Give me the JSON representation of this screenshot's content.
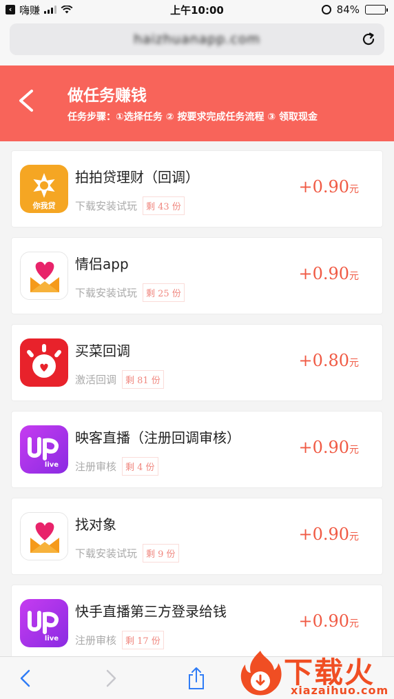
{
  "status_bar": {
    "carrier": "嗨赚",
    "time": "上午10:00",
    "battery": "84%",
    "battery_level": 0.84
  },
  "browser": {
    "url": "haizhuanapp.com"
  },
  "header": {
    "title": "做任务赚钱",
    "steps": "任务步骤：①选择任务 ② 按要求完成任务流程 ③ 领取现金"
  },
  "tasks": [
    {
      "name": "拍拍贷理财（回调）",
      "tag": "下载安装试玩",
      "remaining": "剩 43 份",
      "price": "+0.90",
      "unit": "元",
      "icon": "paipaidai-icon",
      "logo_text": "你我贷"
    },
    {
      "name": "情侣app",
      "tag": "下载安装试玩",
      "remaining": "剩 25 份",
      "price": "+0.90",
      "unit": "元",
      "icon": "heart-envelope-icon"
    },
    {
      "name": "买菜回调",
      "tag": "激活回调",
      "remaining": "剩 81 份",
      "price": "+0.80",
      "unit": "元",
      "icon": "red-face-icon"
    },
    {
      "name": "映客直播（注册回调审核）",
      "tag": "注册审核",
      "remaining": "剩 4 份",
      "price": "+0.90",
      "unit": "元",
      "icon": "up-live-icon",
      "logo_text": "live"
    },
    {
      "name": "找对象",
      "tag": "下载安装试玩",
      "remaining": "剩 9 份",
      "price": "+0.90",
      "unit": "元",
      "icon": "heart-envelope-icon"
    },
    {
      "name": "快手直播第三方登录给钱",
      "tag": "注册审核",
      "remaining": "剩 17 份",
      "price": "+0.90",
      "unit": "元",
      "icon": "up-live-icon",
      "logo_text": "live"
    }
  ],
  "watermark": {
    "name": "下载火",
    "url": "xiazaihuo.com"
  },
  "colors": {
    "header": "#f8645a",
    "price": "#f05a44",
    "watermark": "#f04e23"
  }
}
